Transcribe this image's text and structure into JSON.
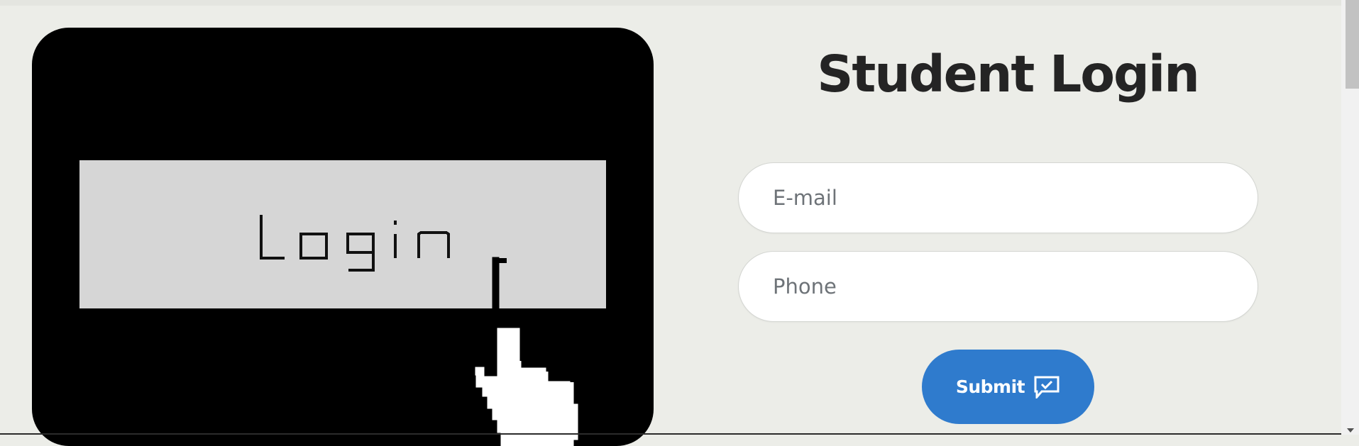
{
  "hero": {
    "button_text": "Login",
    "icon": "pixel-hand-pointer-icon"
  },
  "login": {
    "title": "Student Login",
    "email_placeholder": "E-mail",
    "phone_placeholder": "Phone",
    "submit_label": "Submit",
    "submit_icon": "message-check-icon"
  },
  "colors": {
    "page_background": "#ecede8",
    "hero_background": "#000000",
    "hero_button": "#d6d6d6",
    "title_text": "#242424",
    "submit_background": "#2f7bcd",
    "submit_text": "#ffffff"
  }
}
